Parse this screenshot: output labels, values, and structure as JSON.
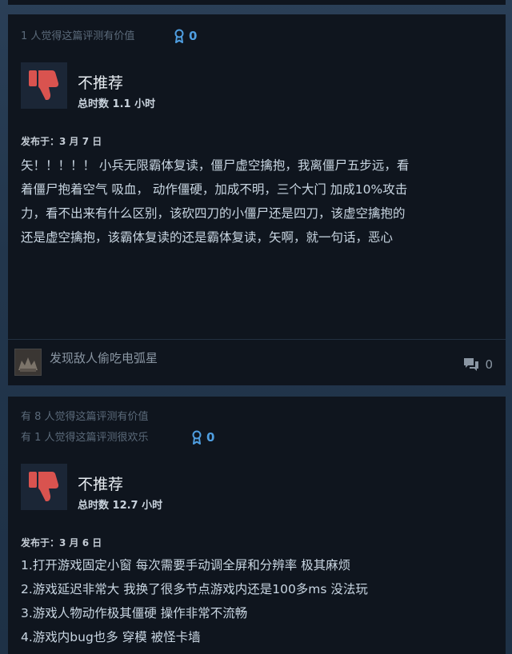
{
  "reviews": [
    {
      "helpful_lines": [
        "1 人觉得这篇评测有价值"
      ],
      "award_count": "0",
      "verdict": "不推荐",
      "hours": "总时数 1.1 小时",
      "posted": "发布于：3 月 7 日",
      "content_lines": [
        "矢！！！！！ 小兵无限霸体复读，僵尸虚空擒抱，我离僵尸五步远，看",
        "着僵尸抱着空气 吸血， 动作僵硬，加成不明，三个大门 加成10%攻击",
        "力，看不出来有什么区别，该砍四刀的小僵尸还是四刀，该虚空擒抱的",
        "还是虚空擒抱，该霸体复读的还是霸体复读，矢啊，就一句话，恶心"
      ],
      "username": "发现敌人偷吃电弧星",
      "comment_count": "0"
    },
    {
      "helpful_lines": [
        "有 8 人觉得这篇评测有价值",
        "有 1 人觉得这篇评测很欢乐"
      ],
      "award_count": "0",
      "verdict": "不推荐",
      "hours": "总时数 12.7 小时",
      "posted": "发布于：3 月 6 日",
      "content_lines": [
        "1.打开游戏固定小窗 每次需要手动调全屏和分辨率 极其麻烦",
        "2.游戏延迟非常大 我换了很多节点游戏内还是100多ms 没法玩",
        "3.游戏人物动作极其僵硬 操作非常不流畅",
        "4.游戏内bug也多 穿模 被怪卡墙"
      ]
    }
  ],
  "colors": {
    "accent_blue": "#4f9ee0",
    "thumb_red": "#d9534f",
    "card_bg": "#0f151e"
  }
}
